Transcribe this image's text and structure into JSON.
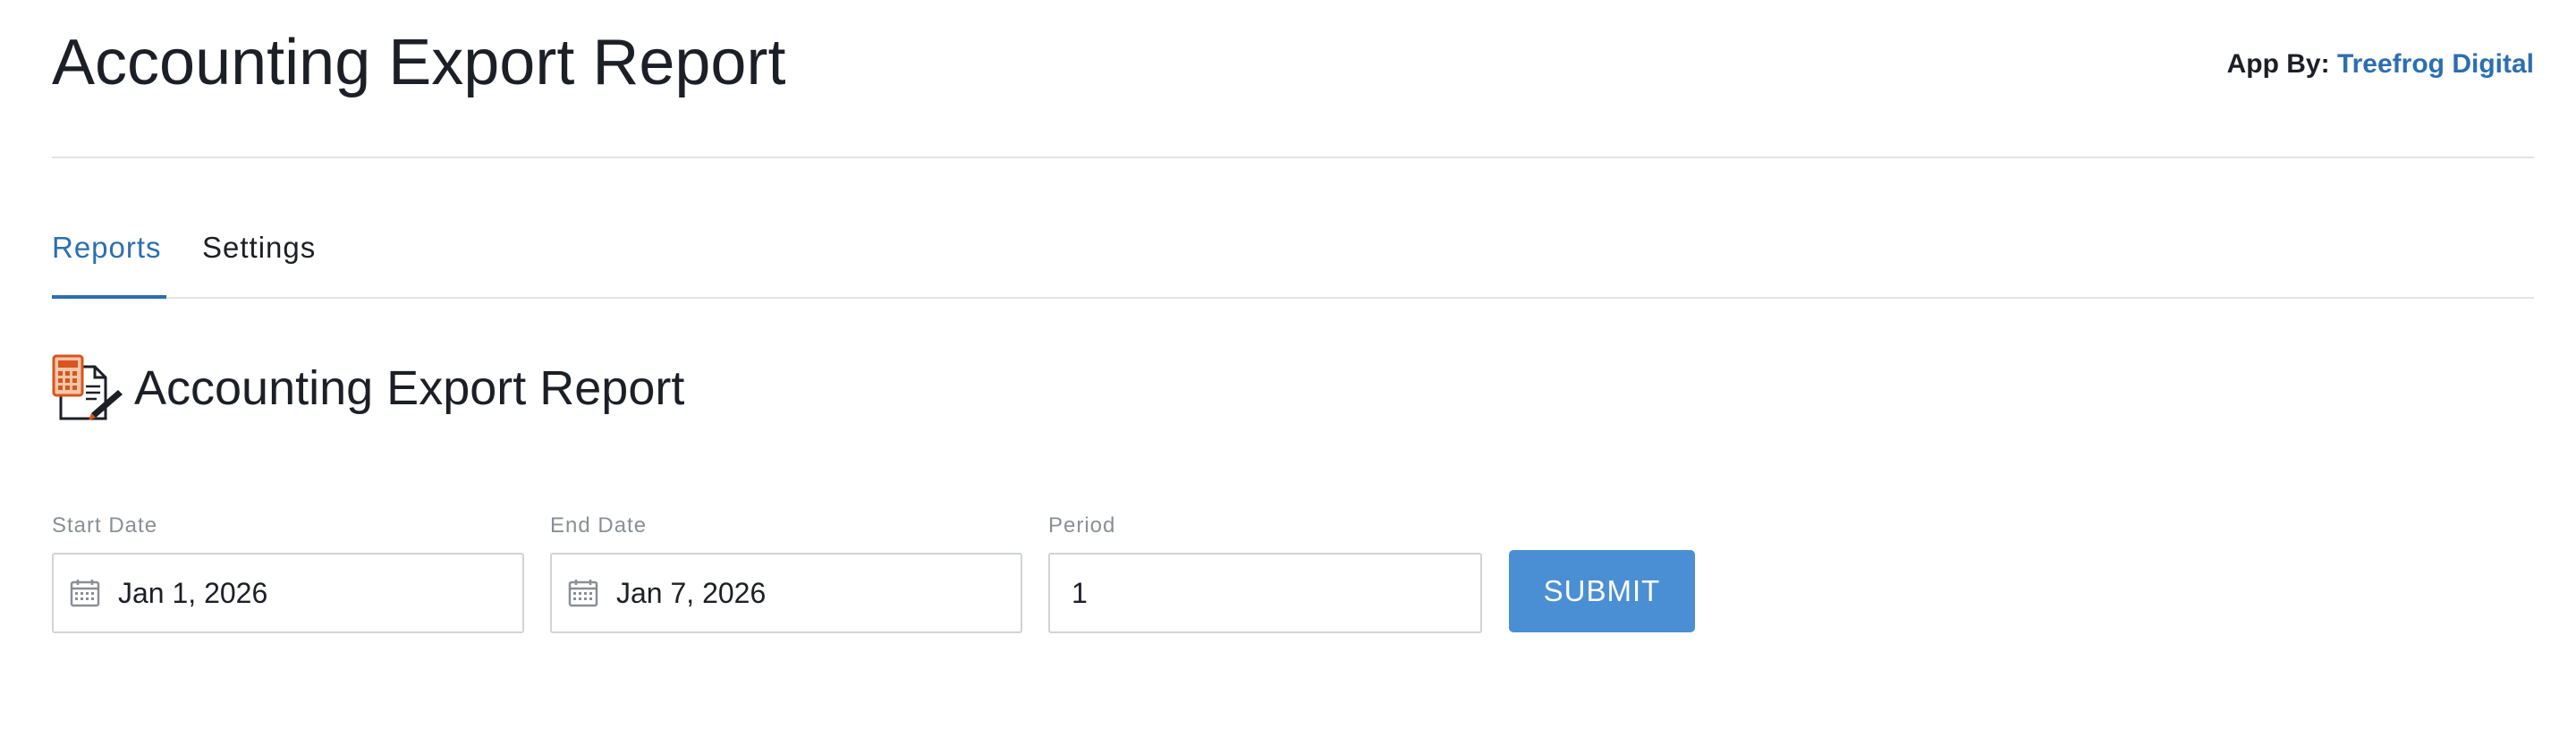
{
  "header": {
    "title": "Accounting Export Report",
    "app_by_label": "App By:",
    "app_by_link": "Treefrog Digital"
  },
  "tabs": [
    {
      "label": "Reports",
      "active": true
    },
    {
      "label": "Settings",
      "active": false
    }
  ],
  "section": {
    "title": "Accounting Export Report",
    "icon": "calculator-document-icon"
  },
  "form": {
    "start_date": {
      "label": "Start Date",
      "value": "Jan 1, 2026",
      "icon": "calendar-icon"
    },
    "end_date": {
      "label": "End Date",
      "value": "Jan 7, 2026",
      "icon": "calendar-icon"
    },
    "period": {
      "label": "Period",
      "value": "1"
    },
    "submit_label": "SUBMIT"
  },
  "colors": {
    "accent": "#2c6fb0",
    "button": "#4a8fd4",
    "text": "#1c1f26",
    "muted_label": "#8a8f96",
    "divider": "#e1e3e6"
  }
}
